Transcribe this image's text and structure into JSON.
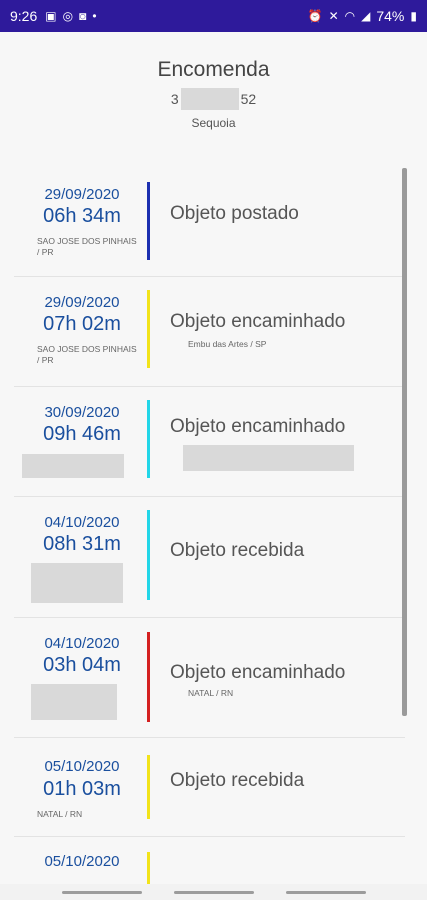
{
  "status_bar": {
    "time": "9:26",
    "battery": "74%",
    "left_icons": [
      "image-icon",
      "whatsapp-icon",
      "instagram-icon",
      "dot-icon"
    ],
    "right_icons": [
      "alarm-icon",
      "mute-icon",
      "wifi-icon",
      "signal-icon",
      "battery-icon"
    ]
  },
  "header": {
    "title": "Encomenda",
    "code_prefix": "3",
    "code_suffix": "52",
    "subtitle": "Sequoia"
  },
  "events": [
    {
      "date": "29/09/2020",
      "time": "06h 34m",
      "location": "SAO JOSE DOS PINHAIS / PR",
      "status": "Objeto postado",
      "status_location": "",
      "bar_color": "#1c2fb0"
    },
    {
      "date": "29/09/2020",
      "time": "07h 02m",
      "location": "SAO JOSE DOS PINHAIS / PR",
      "status": "Objeto encaminhado",
      "status_location": "Embu das Artes / SP",
      "bar_color": "#f2e31a"
    },
    {
      "date": "30/09/2020",
      "time": "09h 46m",
      "location": "",
      "status": "Objeto encaminhado",
      "status_location": "",
      "bar_color": "#22d6e8"
    },
    {
      "date": "04/10/2020",
      "time": "08h 31m",
      "location": "",
      "status": "Objeto recebida",
      "status_location": "",
      "bar_color": "#22d6e8"
    },
    {
      "date": "04/10/2020",
      "time": "03h 04m",
      "location": "",
      "status": "Objeto encaminhado",
      "status_location": "NATAL / RN",
      "bar_color": "#d42020"
    },
    {
      "date": "05/10/2020",
      "time": "01h 03m",
      "location": "NATAL / RN",
      "status": "Objeto recebida",
      "status_location": "",
      "bar_color": "#f2e31a"
    },
    {
      "date": "05/10/2020",
      "time": "",
      "location": "",
      "status": "",
      "status_location": "",
      "bar_color": "#f2e31a"
    }
  ]
}
